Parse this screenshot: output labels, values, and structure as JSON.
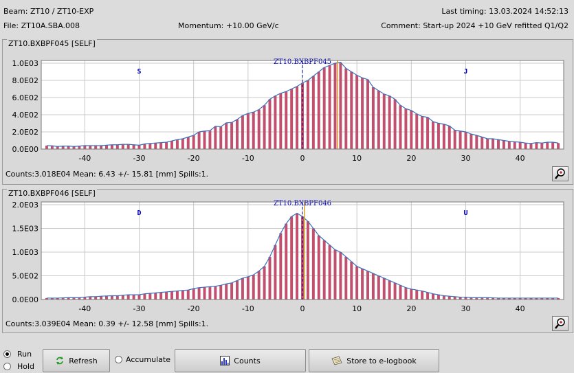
{
  "header": {
    "beam": "Beam: ZT10 / ZT10-EXP",
    "last_timing": "Last timing: 13.03.2024 14:52:13",
    "file": "File: ZT10A.SBA.008",
    "momentum": "Momentum: +10.00 GeV/c",
    "comment": "Comment: Start-up 2024 +10 GeV refitted Q1/Q2"
  },
  "panels": [
    {
      "title": "ZT10.BXBPF045 [SELF]",
      "status": "Counts:3.018E04  Mean: 6.43 +/- 15.81 [mm] Spills:1.",
      "monitor_label": "ZT10.BXBPF045",
      "left_marker": "S",
      "right_marker": "J",
      "marker_x_left": -30,
      "marker_x_right": 30,
      "mean_x": 6.43,
      "y_ticks": [
        "0.0E00",
        "2.0E02",
        "4.0E02",
        "6.0E02",
        "8.0E02",
        "1.0E03"
      ],
      "y_tick_values": [
        0,
        200,
        400,
        600,
        800,
        1000
      ]
    },
    {
      "title": "ZT10.BXBPF046 [SELF]",
      "status": "Counts:3.039E04  Mean: 0.39 +/- 12.58 [mm] Spills:1.",
      "monitor_label": "ZT10.BXBPF046",
      "left_marker": "D",
      "right_marker": "U",
      "marker_x_left": -30,
      "marker_x_right": 30,
      "mean_x": 0.39,
      "y_ticks": [
        "0.0E00",
        "5.0E02",
        "1.0E03",
        "1.5E03",
        "2.0E03"
      ],
      "y_tick_values": [
        0,
        500,
        1000,
        1500,
        2000
      ]
    }
  ],
  "x_ticks": [
    "-40",
    "-30",
    "-20",
    "-10",
    "0",
    "10",
    "20",
    "30",
    "40"
  ],
  "x_tick_values": [
    -40,
    -30,
    -20,
    -10,
    0,
    10,
    20,
    30,
    40
  ],
  "controls": {
    "run_label": "Run",
    "hold_label": "Hold",
    "refresh_label": "Refresh",
    "accumulate_label": "Accumulate",
    "counts_label": "Counts",
    "elogbook_label": "Store to e-logbook",
    "run_selected": true,
    "hold_selected": false,
    "accumulate_selected": false
  },
  "colors": {
    "bar": "#c0506e",
    "line": "#3c6fb8",
    "mean_line": "#d4a020",
    "zero_line": "#000080",
    "marker_text": "#0000c0"
  },
  "chart_data": [
    {
      "type": "bar",
      "title": "ZT10.BXBPF045 [SELF]",
      "xlabel": "",
      "ylabel": "",
      "xlim": [
        -48,
        48
      ],
      "ylim": [
        0,
        1000
      ],
      "x": [
        -47,
        -46,
        -45,
        -44,
        -43,
        -42,
        -41,
        -40,
        -39,
        -38,
        -37,
        -36,
        -35,
        -34,
        -33,
        -32,
        -31,
        -30,
        -29,
        -28,
        -27,
        -26,
        -25,
        -24,
        -23,
        -22,
        -21,
        -20,
        -19,
        -18,
        -17,
        -16,
        -15,
        -14,
        -13,
        -12,
        -11,
        -10,
        -9,
        -8,
        -7,
        -6,
        -5,
        -4,
        -3,
        -2,
        -1,
        0,
        1,
        2,
        3,
        4,
        5,
        6,
        7,
        8,
        9,
        10,
        11,
        12,
        13,
        14,
        15,
        16,
        17,
        18,
        19,
        20,
        21,
        22,
        23,
        24,
        25,
        26,
        27,
        28,
        29,
        30,
        31,
        32,
        33,
        34,
        35,
        36,
        37,
        38,
        39,
        40,
        41,
        42,
        43,
        44,
        45,
        46,
        47
      ],
      "values": [
        40,
        38,
        30,
        35,
        35,
        30,
        35,
        40,
        40,
        40,
        40,
        45,
        50,
        50,
        55,
        55,
        50,
        45,
        60,
        65,
        70,
        75,
        80,
        95,
        110,
        120,
        140,
        160,
        200,
        210,
        215,
        265,
        260,
        305,
        310,
        345,
        390,
        415,
        430,
        460,
        510,
        580,
        620,
        650,
        670,
        700,
        730,
        770,
        800,
        850,
        900,
        950,
        975,
        1000,
        1010,
        940,
        900,
        860,
        830,
        810,
        720,
        680,
        640,
        620,
        580,
        510,
        470,
        450,
        410,
        380,
        370,
        320,
        300,
        290,
        270,
        220,
        210,
        200,
        175,
        160,
        140,
        120,
        120,
        110,
        100,
        90,
        85,
        80,
        70,
        65,
        75,
        70,
        80,
        80,
        70,
        65,
        70
      ]
    },
    {
      "type": "bar",
      "title": "ZT10.BXBPF046 [SELF]",
      "xlabel": "",
      "ylabel": "",
      "xlim": [
        -48,
        48
      ],
      "ylim": [
        0,
        2000
      ],
      "x": [
        -47,
        -46,
        -45,
        -44,
        -43,
        -42,
        -41,
        -40,
        -39,
        -38,
        -37,
        -36,
        -35,
        -34,
        -33,
        -32,
        -31,
        -30,
        -29,
        -28,
        -27,
        -26,
        -25,
        -24,
        -23,
        -22,
        -21,
        -20,
        -19,
        -18,
        -17,
        -16,
        -15,
        -14,
        -13,
        -12,
        -11,
        -10,
        -9,
        -8,
        -7,
        -6,
        -5,
        -4,
        -3,
        -2,
        -1,
        0,
        1,
        2,
        3,
        4,
        5,
        6,
        7,
        8,
        9,
        10,
        11,
        12,
        13,
        14,
        15,
        16,
        17,
        18,
        19,
        20,
        21,
        22,
        23,
        24,
        25,
        26,
        27,
        28,
        29,
        30,
        31,
        32,
        33,
        34,
        35,
        36,
        37,
        38,
        39,
        40,
        41,
        42,
        43,
        44,
        45,
        46,
        47
      ],
      "values": [
        30,
        30,
        30,
        35,
        40,
        40,
        40,
        50,
        60,
        60,
        70,
        75,
        80,
        80,
        90,
        100,
        100,
        100,
        120,
        130,
        140,
        150,
        160,
        170,
        180,
        190,
        200,
        230,
        250,
        260,
        270,
        280,
        300,
        330,
        350,
        400,
        450,
        480,
        520,
        600,
        700,
        900,
        1150,
        1400,
        1600,
        1750,
        1820,
        1750,
        1650,
        1500,
        1350,
        1250,
        1150,
        1050,
        1000,
        900,
        800,
        700,
        650,
        600,
        550,
        500,
        450,
        400,
        350,
        300,
        250,
        220,
        200,
        180,
        150,
        120,
        100,
        80,
        70,
        60,
        50,
        50,
        40,
        40,
        40,
        40,
        35,
        30,
        30,
        30,
        30,
        30,
        30,
        30,
        30,
        30,
        30,
        30,
        30,
        30,
        30
      ]
    }
  ]
}
